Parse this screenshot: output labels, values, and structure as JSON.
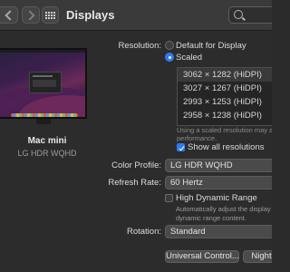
{
  "window": {
    "title": "Displays"
  },
  "display": {
    "name": "Mac mini",
    "model": "LG HDR WQHD"
  },
  "resolution": {
    "label": "Resolution:",
    "options": [
      {
        "label": "Default for Display",
        "selected": false
      },
      {
        "label": "Scaled",
        "selected": true
      }
    ],
    "scaled_list": [
      "3062 × 1282 (HiDPI)",
      "3027 × 1267 (HiDPI)",
      "2993 × 1253 (HiDPI)",
      "2958 × 1238 (HiDPI)"
    ],
    "hint": "Using a scaled resolution may a performance.",
    "show_all": {
      "label": "Show all resolutions",
      "checked": true
    }
  },
  "color_profile": {
    "label": "Color Profile:",
    "value": "LG HDR WQHD"
  },
  "refresh_rate": {
    "label": "Refresh Rate:",
    "value": "60 Hertz"
  },
  "hdr": {
    "label": "High Dynamic Range",
    "checked": false,
    "description": "Automatically adjust the display dynamic range content."
  },
  "rotation": {
    "label": "Rotation:",
    "value": "Standard"
  },
  "buttons": {
    "universal_control": "Universal Control...",
    "night_shift": "Night S"
  },
  "colors": {
    "accent": "#2f7bef",
    "background": "#2c2c2c",
    "toolbar": "#3a3a3a"
  }
}
